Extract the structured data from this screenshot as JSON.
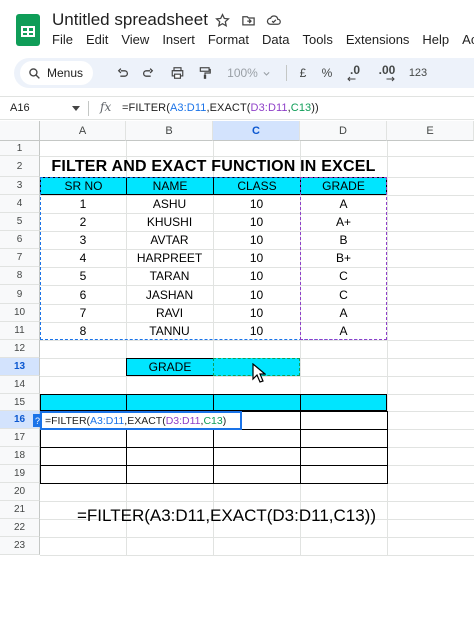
{
  "app": {
    "title": "Untitled spreadsheet"
  },
  "menu": [
    "File",
    "Edit",
    "View",
    "Insert",
    "Format",
    "Data",
    "Tools",
    "Extensions",
    "Help",
    "Ac"
  ],
  "toolbar": {
    "menus_label": "Menus",
    "zoom": "100%",
    "currency": "£",
    "percent": "%",
    "dec_decrease": ".0",
    "dec_increase": ".00",
    "number_format": "123"
  },
  "formula_bar": {
    "name_box": "A16",
    "fx_label": "fx",
    "prefix": "=FILTER(",
    "ref1": "A3:D11",
    "mid": ",EXACT(",
    "ref2": "D3:D11",
    "comma": ",",
    "ref3": "C13",
    "suffix": "))"
  },
  "grid": {
    "columns": [
      "A",
      "B",
      "C",
      "D",
      "E"
    ],
    "rows": [
      "1",
      "2",
      "3",
      "4",
      "5",
      "6",
      "7",
      "8",
      "9",
      "10",
      "11",
      "12",
      "13",
      "14",
      "15",
      "16",
      "17",
      "18",
      "19",
      "20",
      "21",
      "22",
      "23"
    ],
    "title": "FILTER AND EXACT FUNCTION IN EXCEL",
    "headers": [
      "SR NO",
      "NAME",
      "CLASS",
      "GRADE"
    ],
    "data": [
      [
        "1",
        "ASHU",
        "10",
        "A"
      ],
      [
        "2",
        "KHUSHI",
        "10",
        "A+"
      ],
      [
        "3",
        "AVTAR",
        "10",
        "B"
      ],
      [
        "4",
        "HARPREET",
        "10",
        "B+"
      ],
      [
        "5",
        "TARAN",
        "10",
        "C"
      ],
      [
        "6",
        "JASHAN",
        "10",
        "C"
      ],
      [
        "7",
        "RAVI",
        "10",
        "A"
      ],
      [
        "8",
        "TANNU",
        "10",
        "A"
      ]
    ],
    "grade_label": "GRADE",
    "grade_value": "",
    "editing_cell": "A16",
    "edit_badge": "?",
    "edit_text": {
      "prefix": "=FILTER(",
      "ref1": "A3:D11",
      "mid": ",EXACT(",
      "ref2": "D3:D11",
      "comma": ",",
      "ref3": "C13",
      "suffix": ")"
    }
  },
  "caption": "=FILTER(A3:D11,EXACT(D3:D11,C13))",
  "colors": {
    "header_fill": "#00e5ff",
    "ref_range1": "#1a73e8",
    "ref_range2": "#8e3fc8",
    "ref_range3": "#0f9d58",
    "sheets_green": "#0f9d58"
  }
}
